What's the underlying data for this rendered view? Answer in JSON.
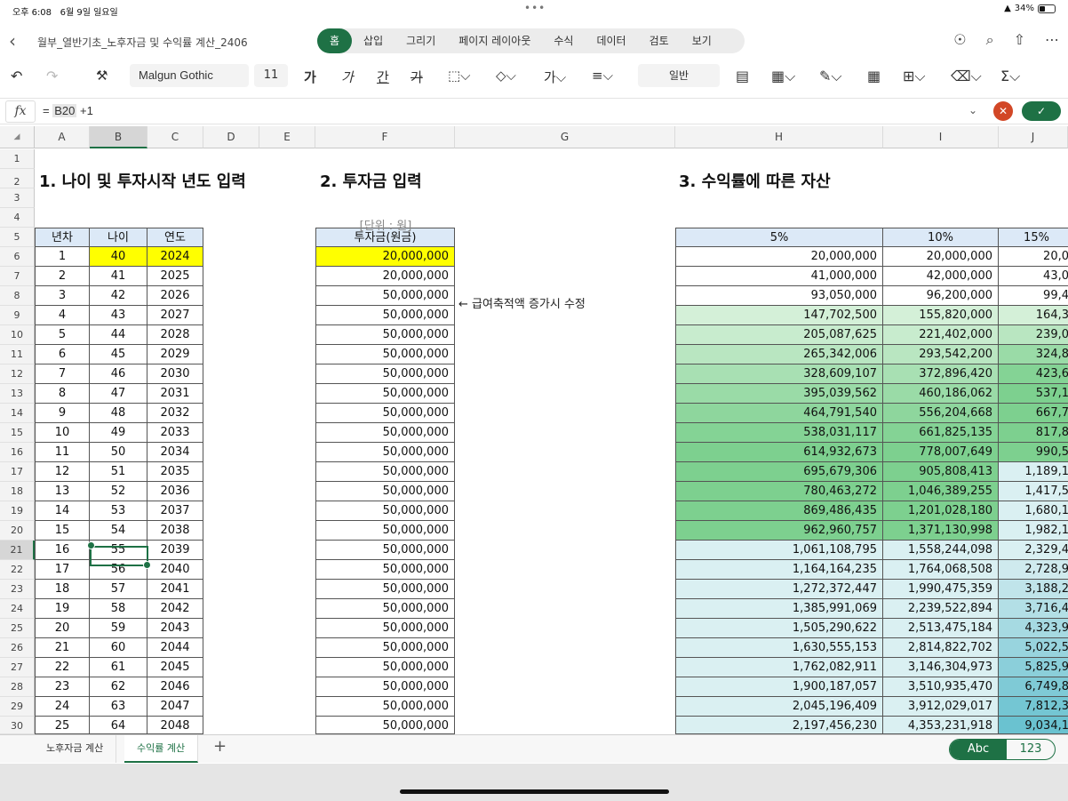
{
  "status": {
    "time": "오후 6:08",
    "date": "6월 9일 일요일",
    "battery": "34%",
    "more": "•••"
  },
  "document": {
    "title": "월부_열반기초_노후자금 및 수익률 계산_2406"
  },
  "ribbon_tabs": [
    "홈",
    "삽입",
    "그리기",
    "페이지 레이아웃",
    "수식",
    "데이터",
    "검토",
    "보기"
  ],
  "toolbar": {
    "font": "Malgun Gothic",
    "size": "11",
    "bold": "가",
    "italic": "가",
    "underline": "간",
    "strike": "가",
    "format": "일반",
    "sum": "Σ"
  },
  "formula": {
    "ref": "B20",
    "prefix": "= ",
    "suffix": " +1"
  },
  "columns": [
    "A",
    "B",
    "C",
    "D",
    "E",
    "F",
    "G",
    "H",
    "I",
    "J"
  ],
  "headings": {
    "h1": "1. 나이 및 투자시작 년도 입력",
    "h2": "2. 투자금 입력",
    "h3": "3. 수익률에 따른 자산"
  },
  "unit_label": "[단위 : 원]",
  "note": "← 급여축적액 증가시 수정",
  "table1": {
    "headers": [
      "년차",
      "나이",
      "연도"
    ],
    "rows": [
      [
        "1",
        "40",
        "2024"
      ],
      [
        "2",
        "41",
        "2025"
      ],
      [
        "3",
        "42",
        "2026"
      ],
      [
        "4",
        "43",
        "2027"
      ],
      [
        "5",
        "44",
        "2028"
      ],
      [
        "6",
        "45",
        "2029"
      ],
      [
        "7",
        "46",
        "2030"
      ],
      [
        "8",
        "47",
        "2031"
      ],
      [
        "9",
        "48",
        "2032"
      ],
      [
        "10",
        "49",
        "2033"
      ],
      [
        "11",
        "50",
        "2034"
      ],
      [
        "12",
        "51",
        "2035"
      ],
      [
        "13",
        "52",
        "2036"
      ],
      [
        "14",
        "53",
        "2037"
      ],
      [
        "15",
        "54",
        "2038"
      ],
      [
        "16",
        "55",
        "2039"
      ],
      [
        "17",
        "56",
        "2040"
      ],
      [
        "18",
        "57",
        "2041"
      ],
      [
        "19",
        "58",
        "2042"
      ],
      [
        "20",
        "59",
        "2043"
      ],
      [
        "21",
        "60",
        "2044"
      ],
      [
        "22",
        "61",
        "2045"
      ],
      [
        "23",
        "62",
        "2046"
      ],
      [
        "24",
        "63",
        "2047"
      ],
      [
        "25",
        "64",
        "2048"
      ]
    ]
  },
  "table2": {
    "header": "투자금(원금)",
    "rows": [
      "20,000,000",
      "20,000,000",
      "50,000,000",
      "50,000,000",
      "50,000,000",
      "50,000,000",
      "50,000,000",
      "50,000,000",
      "50,000,000",
      "50,000,000",
      "50,000,000",
      "50,000,000",
      "50,000,000",
      "50,000,000",
      "50,000,000",
      "50,000,000",
      "50,000,000",
      "50,000,000",
      "50,000,000",
      "50,000,000",
      "50,000,000",
      "50,000,000",
      "50,000,000",
      "50,000,000",
      "50,000,000"
    ]
  },
  "table3": {
    "headers": [
      "5%",
      "10%",
      "15%"
    ],
    "h": [
      "20,000,000",
      "41,000,000",
      "93,050,000",
      "147,702,500",
      "205,087,625",
      "265,342,006",
      "328,609,107",
      "395,039,562",
      "464,791,540",
      "538,031,117",
      "614,932,673",
      "695,679,306",
      "780,463,272",
      "869,486,435",
      "962,960,757",
      "1,061,108,795",
      "1,164,164,235",
      "1,272,372,447",
      "1,385,991,069",
      "1,505,290,622",
      "1,630,555,153",
      "1,762,082,911",
      "1,900,187,057",
      "2,045,196,409",
      "2,197,456,230"
    ],
    "i": [
      "20,000,000",
      "42,000,000",
      "96,200,000",
      "155,820,000",
      "221,402,000",
      "293,542,200",
      "372,896,420",
      "460,186,062",
      "556,204,668",
      "661,825,135",
      "778,007,649",
      "905,808,413",
      "1,046,389,255",
      "1,201,028,180",
      "1,371,130,998",
      "1,558,244,098",
      "1,764,068,508",
      "1,990,475,359",
      "2,239,522,894",
      "2,513,475,184",
      "2,814,822,702",
      "3,146,304,973",
      "3,510,935,470",
      "3,912,029,017",
      "4,353,231,918"
    ],
    "j": [
      "20,0",
      "43,0",
      "99,4",
      "164,3",
      "239,0",
      "324,8",
      "423,6",
      "537,1",
      "667,7",
      "817,8",
      "990,5",
      "1,189,1",
      "1,417,5",
      "1,680,1",
      "1,982,1",
      "2,329,4",
      "2,728,9",
      "3,188,2",
      "3,716,4",
      "4,323,9",
      "5,022,5",
      "5,825,9",
      "6,749,8",
      "7,812,3",
      "9,034,1"
    ]
  },
  "sheets": [
    "노후자금 계산",
    "수익률 계산"
  ],
  "input_mode": {
    "abc": "Abc",
    "num": "123"
  },
  "colors": {
    "accent": "#1e7145",
    "header_fill": "#dce9f7",
    "input_fill": "#ffff00",
    "cancel": "#d24726"
  }
}
